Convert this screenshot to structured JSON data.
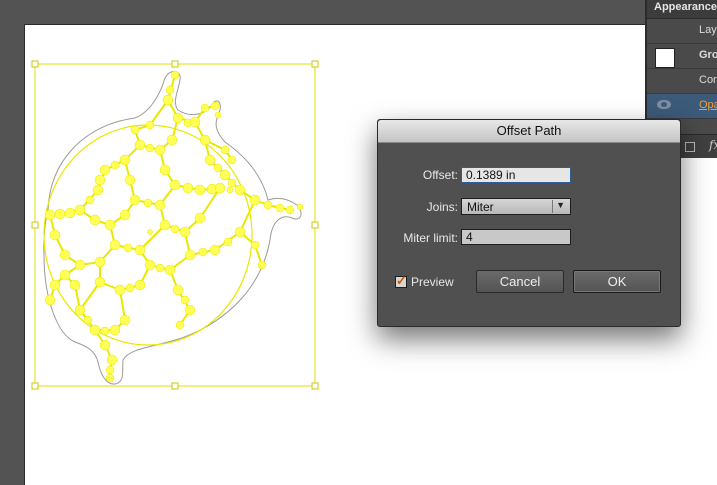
{
  "panel": {
    "title": "Appearance",
    "rows": [
      {
        "label": "Laye"
      },
      {
        "label": "Gro"
      },
      {
        "label": "Con"
      },
      {
        "label": "Opa"
      }
    ],
    "footer_fx": "fx"
  },
  "dialog": {
    "title": "Offset Path",
    "offset_label": "Offset:",
    "offset_value": "0.1389 in",
    "joins_label": "Joins:",
    "joins_value": "Miter",
    "miter_label": "Miter limit:",
    "miter_value": "4",
    "preview_label": "Preview",
    "preview_checked": true,
    "cancel_label": "Cancel",
    "ok_label": "OK"
  },
  "colors": {
    "selection": "#ffff55",
    "selection_outline": "#e5e500",
    "accent": "#d05a00"
  }
}
